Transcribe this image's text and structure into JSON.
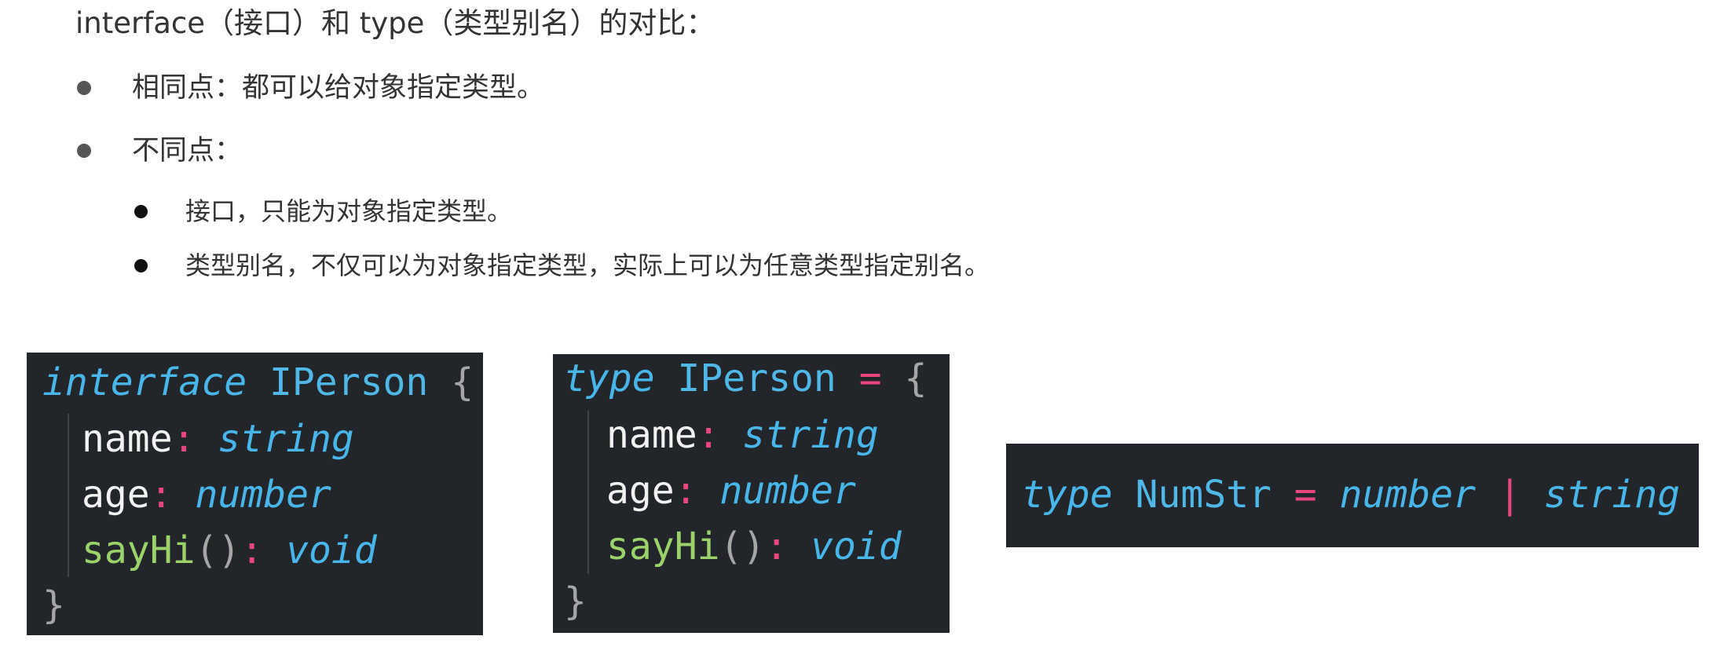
{
  "heading": "interface（接口）和 type（类型别名）的对比：",
  "bullets": [
    {
      "text": "相同点：都可以给对象指定类型。"
    },
    {
      "text": "不同点："
    }
  ],
  "sub_bullets": [
    {
      "text": "接口，只能为对象指定类型。"
    },
    {
      "text": "类型别名，不仅可以为对象指定类型，实际上可以为任意类型指定别名。"
    }
  ],
  "code_interface": {
    "keyword": "interface",
    "name": "IPerson",
    "open_brace": "{",
    "fields": [
      {
        "prop": "name",
        "colon": ":",
        "type": "string"
      },
      {
        "prop": "age",
        "colon": ":",
        "type": "number"
      }
    ],
    "method": {
      "prop": "sayHi",
      "parens": "()",
      "colon": ":",
      "type": "void"
    },
    "close_brace": "}"
  },
  "code_type": {
    "keyword": "type",
    "name": "IPerson",
    "equals": "=",
    "open_brace": "{",
    "fields": [
      {
        "prop": "name",
        "colon": ":",
        "type": "string"
      },
      {
        "prop": "age",
        "colon": ":",
        "type": "number"
      }
    ],
    "method": {
      "prop": "sayHi",
      "parens": "()",
      "colon": ":",
      "type": "void"
    },
    "close_brace": "}"
  },
  "code_union": {
    "keyword": "type",
    "name": "NumStr",
    "equals": "=",
    "type_a": "number",
    "pipe": "|",
    "type_b": "string"
  },
  "colors": {
    "code_background": "#22262b",
    "keyword": "#48b6e8",
    "operator": "#e8467c",
    "function": "#9bd36a",
    "property": "#f2f2f2",
    "brace": "#a6a6a6"
  }
}
